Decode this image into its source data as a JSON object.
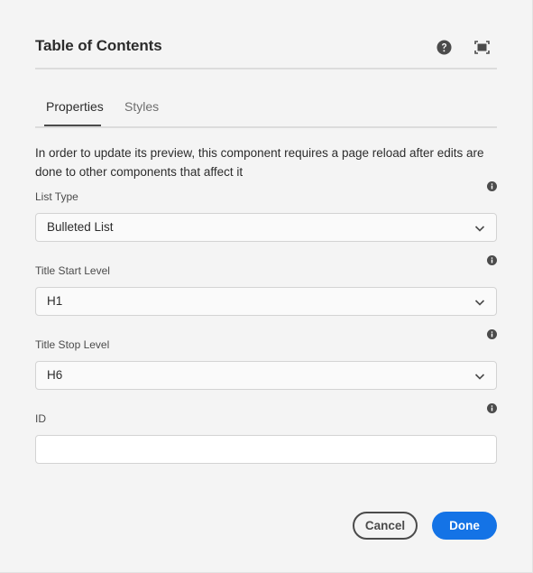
{
  "dialog": {
    "title": "Table of Contents",
    "help_icon": "help-circle-icon",
    "fullscreen_icon": "fullscreen-icon"
  },
  "tabs": [
    {
      "label": "Properties",
      "active": true
    },
    {
      "label": "Styles",
      "active": false
    }
  ],
  "notice": "In order to update its preview, this component requires a page reload after edits are done to other components that affect it",
  "fields": {
    "list_type": {
      "label": "List Type",
      "value": "Bulleted List"
    },
    "title_start": {
      "label": "Title Start Level",
      "value": "H1"
    },
    "title_stop": {
      "label": "Title Stop Level",
      "value": "H6"
    },
    "id": {
      "label": "ID",
      "value": "",
      "placeholder": ""
    }
  },
  "buttons": {
    "cancel": "Cancel",
    "done": "Done"
  },
  "colors": {
    "accent": "#1473e6",
    "text": "#2c2c2c",
    "background": "#f4f4f4"
  }
}
